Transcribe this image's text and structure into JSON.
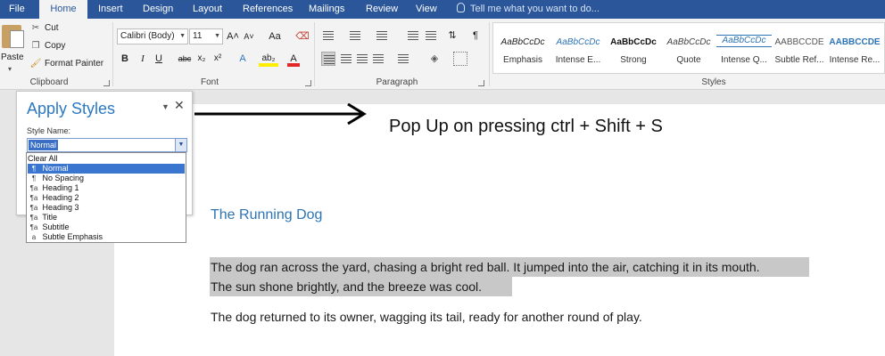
{
  "tabs": [
    {
      "label": "File",
      "active": false
    },
    {
      "label": "Home",
      "active": true
    },
    {
      "label": "Insert",
      "active": false
    },
    {
      "label": "Design",
      "active": false
    },
    {
      "label": "Layout",
      "active": false
    },
    {
      "label": "References",
      "active": false
    },
    {
      "label": "Mailings",
      "active": false
    },
    {
      "label": "Review",
      "active": false
    },
    {
      "label": "View",
      "active": false
    }
  ],
  "tell_me": "Tell me what you want to do...",
  "clipboard": {
    "paste": "Paste",
    "cut": "Cut",
    "copy": "Copy",
    "format_painter": "Format Painter",
    "group_label": "Clipboard"
  },
  "font": {
    "name": "Calibri (Body)",
    "size": "11",
    "grow": "A˄",
    "shrink": "A˅",
    "change_case": "Aa",
    "bold": "B",
    "italic": "I",
    "underline": "U",
    "strikethrough": "abc",
    "subscript": "x₂",
    "superscript": "x²",
    "text_effects": "A",
    "highlight": "ab₂",
    "font_color": "A",
    "group_label": "Font"
  },
  "paragraph": {
    "pilcrow": "¶",
    "group_label": "Paragraph"
  },
  "styles": {
    "group_label": "Styles",
    "items": [
      {
        "preview": "AaBbCcDc",
        "name": "Emphasis",
        "color": "#222222",
        "italic": true,
        "bold": false
      },
      {
        "preview": "AaBbCcDc",
        "name": "Intense E...",
        "color": "#2e74b5",
        "italic": true,
        "bold": false
      },
      {
        "preview": "AaBbCcDc",
        "name": "Strong",
        "color": "#111111",
        "italic": false,
        "bold": true
      },
      {
        "preview": "AaBbCcDc",
        "name": "Quote",
        "color": "#444444",
        "italic": true,
        "bold": false
      },
      {
        "preview": "AaBbCcDc",
        "name": "Intense Q...",
        "color": "#2e74b5",
        "italic": true,
        "bold": false
      },
      {
        "preview": "AABBCCDE",
        "name": "Subtle Ref...",
        "color": "#555555",
        "italic": false,
        "bold": false
      },
      {
        "preview": "AABBCCDE",
        "name": "Intense Re...",
        "color": "#2e74b5",
        "italic": false,
        "bold": true
      }
    ]
  },
  "apply_styles": {
    "title": "Apply Styles",
    "style_name_label": "Style Name:",
    "value": "Normal",
    "options": [
      {
        "glyph": "",
        "label": "Clear All"
      },
      {
        "glyph": "¶",
        "label": "Normal",
        "selected": true
      },
      {
        "glyph": "¶",
        "label": "No Spacing"
      },
      {
        "glyph": "¶a",
        "label": "Heading 1"
      },
      {
        "glyph": "¶a",
        "label": "Heading 2"
      },
      {
        "glyph": "¶a",
        "label": "Heading 3"
      },
      {
        "glyph": "¶a",
        "label": "Title"
      },
      {
        "glyph": "¶a",
        "label": "Subtitle"
      },
      {
        "glyph": "a",
        "label": "Subtle Emphasis"
      }
    ]
  },
  "annotation": "Pop Up on pressing ctrl + Shift + S",
  "document": {
    "title": "The Running Dog",
    "para1_line1": "The dog ran across the yard, chasing a bright red ball. It jumped into the air, catching it in its mouth.",
    "para1_line2": "The sun shone brightly, and the breeze was cool.",
    "para2": "The dog returned to its owner, wagging its tail, ready for another round of play."
  },
  "colors": {
    "ribbon_blue": "#2b579a",
    "heading_blue": "#2e74b5",
    "selection_gray": "#c8c8c8"
  }
}
